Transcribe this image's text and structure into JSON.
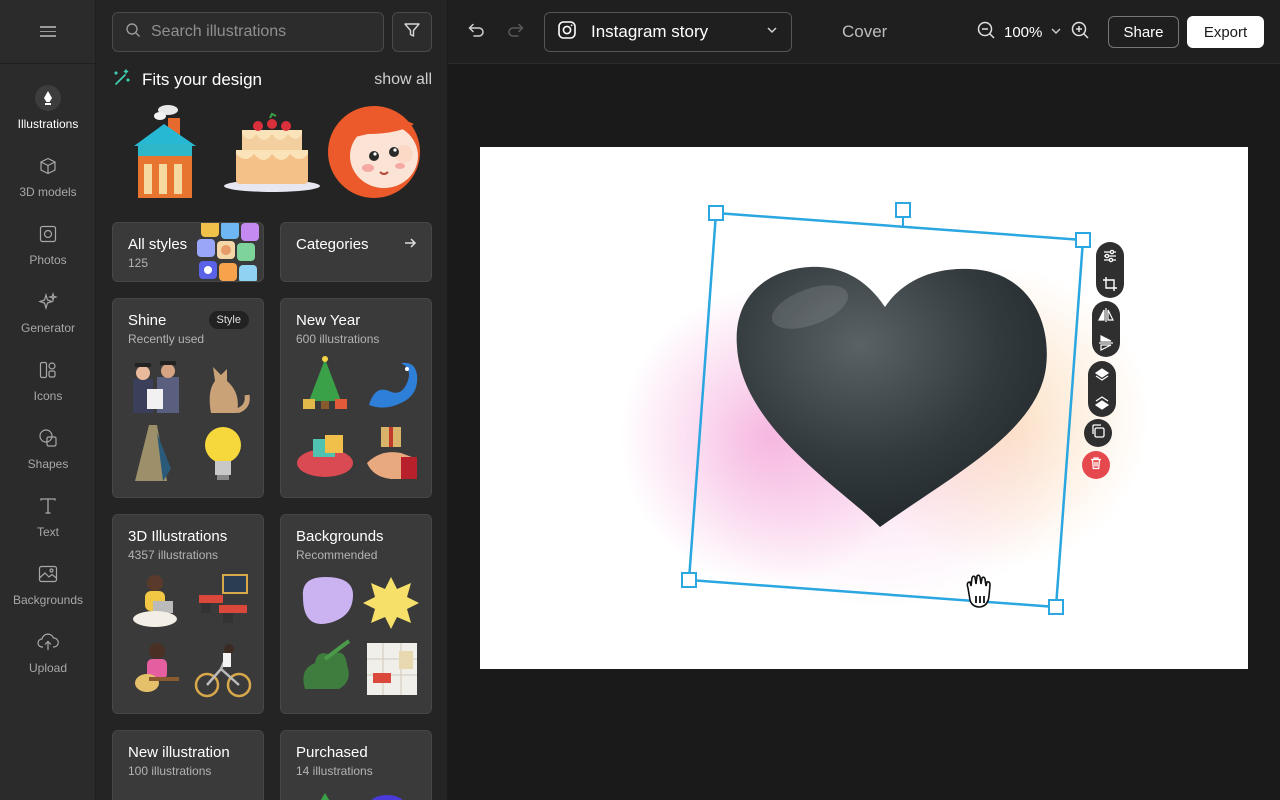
{
  "rail": {
    "items": [
      {
        "label": "Illustrations",
        "icon": "pen-nib-icon"
      },
      {
        "label": "3D models",
        "icon": "cube-icon"
      },
      {
        "label": "Photos",
        "icon": "photo-icon"
      },
      {
        "label": "Generator",
        "icon": "sparkles-icon"
      },
      {
        "label": "Icons",
        "icon": "icons-icon"
      },
      {
        "label": "Shapes",
        "icon": "shapes-icon"
      },
      {
        "label": "Text",
        "icon": "text-icon"
      },
      {
        "label": "Backgrounds",
        "icon": "image-icon"
      },
      {
        "label": "Upload",
        "icon": "upload-cloud-icon"
      }
    ]
  },
  "panel": {
    "search_placeholder": "Search illustrations",
    "fits": {
      "title": "Fits your design",
      "action": "show all"
    },
    "cards": {
      "all_styles": {
        "title": "All styles",
        "subtitle": "125"
      },
      "categories": {
        "title": "Categories"
      },
      "shine": {
        "title": "Shine",
        "subtitle": "Recently used",
        "badge": "Style"
      },
      "new_year": {
        "title": "New Year",
        "subtitle": "600 illustrations"
      },
      "three_d": {
        "title": "3D Illustrations",
        "subtitle": "4357 illustrations"
      },
      "backgrounds": {
        "title": "Backgrounds",
        "subtitle": "Recommended"
      },
      "new_illustration": {
        "title": "New illustration",
        "subtitle": "100 illustrations"
      },
      "purchased": {
        "title": "Purchased",
        "subtitle": "14 illustrations"
      }
    }
  },
  "topbar": {
    "format": "Instagram story",
    "cover": "Cover",
    "zoom": "100%",
    "share": "Share",
    "export": "Export"
  },
  "colors": {
    "accent": "#2aa6e0",
    "delete": "#e5484d",
    "canvas": "#ffffff",
    "panel": "#242424"
  }
}
